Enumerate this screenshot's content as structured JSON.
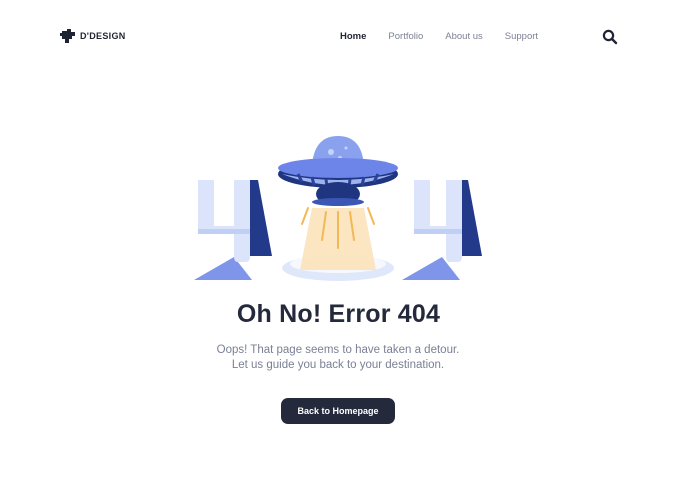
{
  "brand": {
    "name": "D'DESIGN"
  },
  "nav": {
    "items": [
      {
        "label": "Home",
        "active": true
      },
      {
        "label": "Portfolio",
        "active": false
      },
      {
        "label": "About us",
        "active": false
      },
      {
        "label": "Support",
        "active": false
      }
    ]
  },
  "header": {
    "search_icon": "search-icon"
  },
  "error": {
    "title": "Oh No! Error 404",
    "description": "Oops! That page seems to have taken a detour. Let us guide you back to your destination.",
    "button_label": "Back to Homepage"
  },
  "illustration": {
    "digit_left": "4",
    "digit_right": "4",
    "center": "ufo"
  },
  "colors": {
    "dark": "#242a3b",
    "muted": "#7a8195",
    "accent": "#6d84e8",
    "light": "#dfe8fb"
  }
}
